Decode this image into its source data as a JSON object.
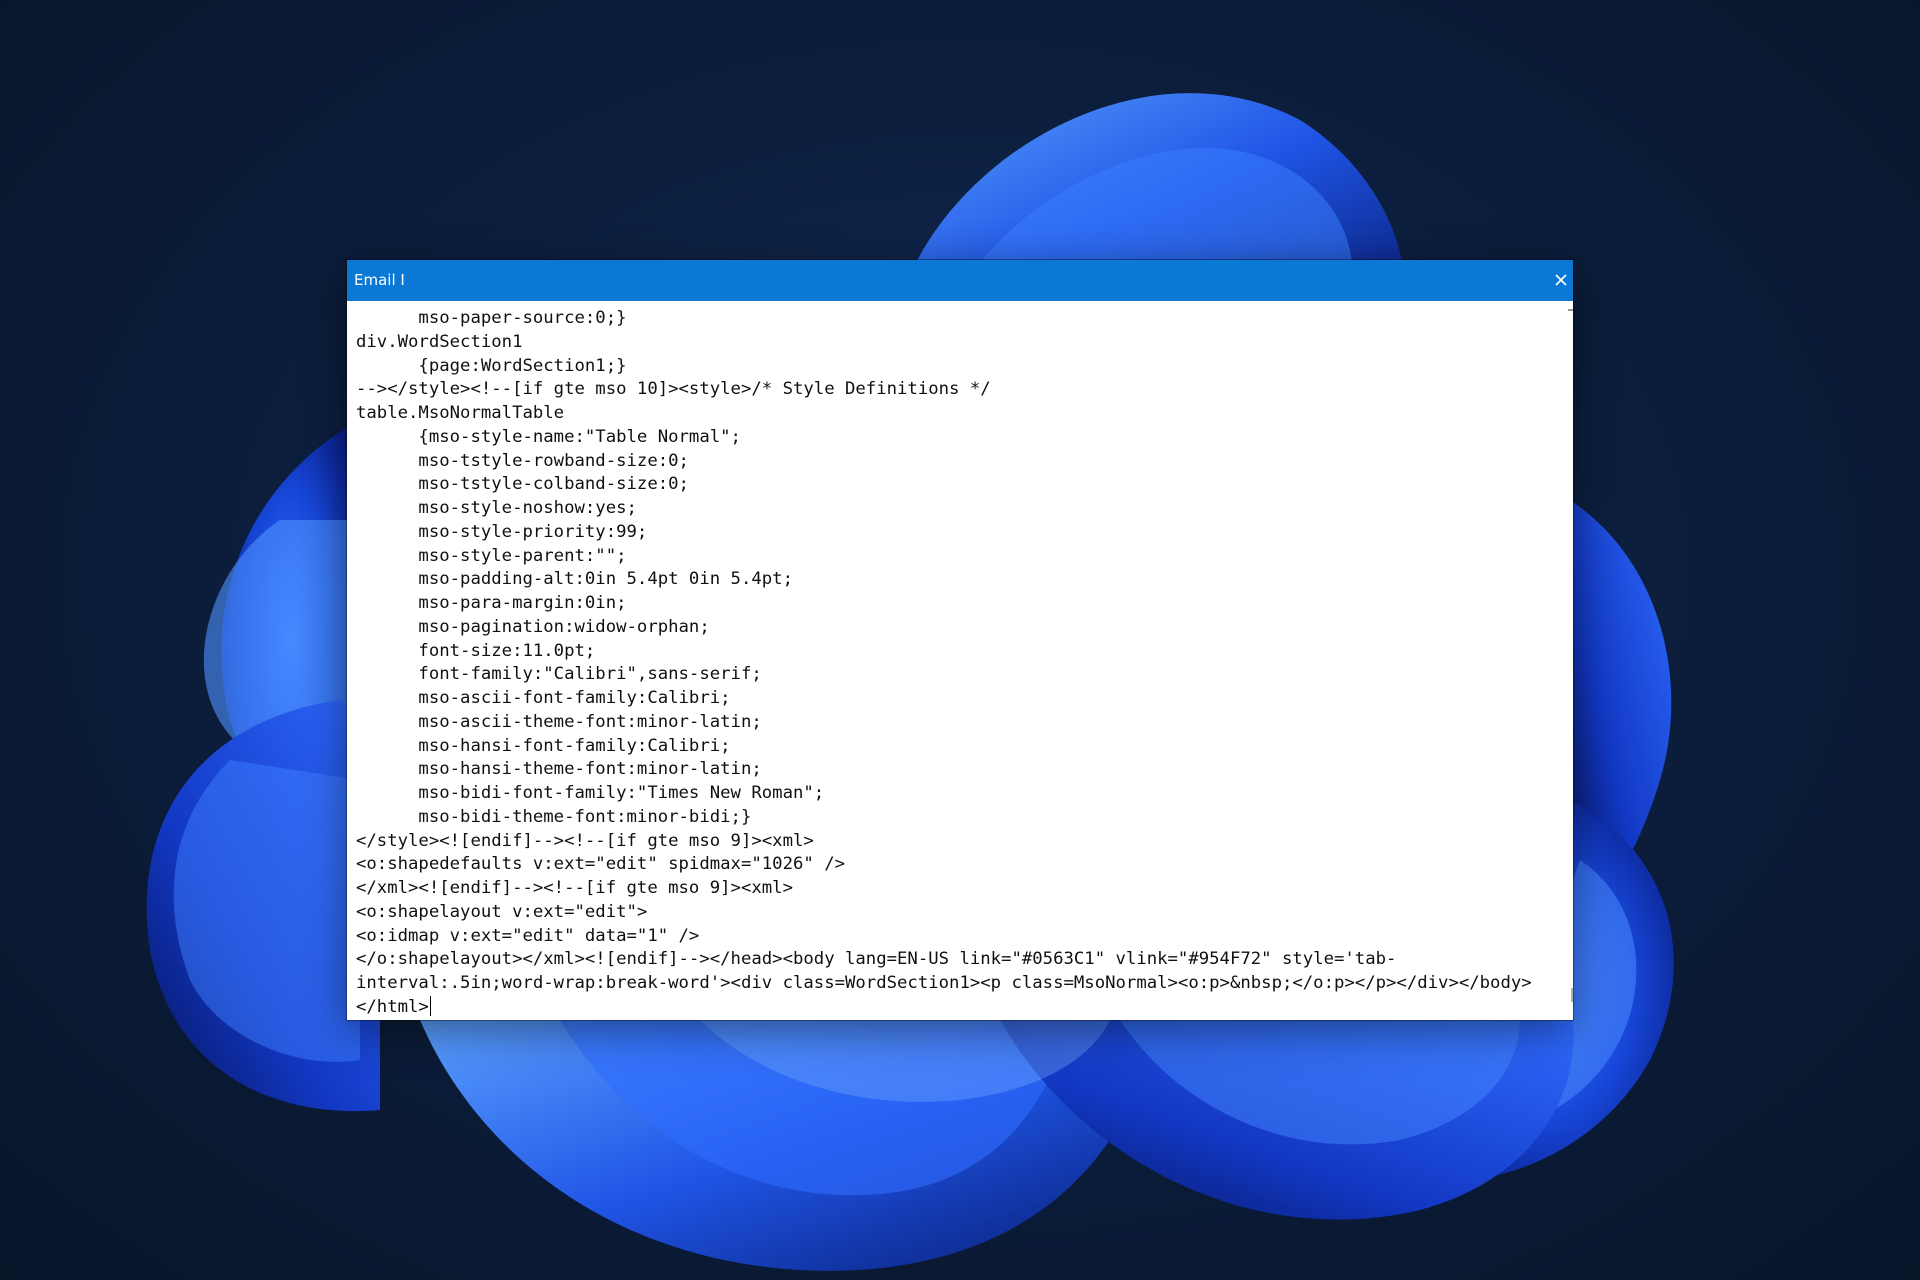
{
  "window": {
    "title": "Email I",
    "accent_color": "#0a78d4",
    "close_icon": "close-icon"
  },
  "editor": {
    "lines": [
      "      mso-paper-source:0;}",
      "div.WordSection1",
      "      {page:WordSection1;}",
      "--></style><!--[if gte mso 10]><style>/* Style Definitions */",
      "table.MsoNormalTable",
      "      {mso-style-name:\"Table Normal\";",
      "      mso-tstyle-rowband-size:0;",
      "      mso-tstyle-colband-size:0;",
      "      mso-style-noshow:yes;",
      "      mso-style-priority:99;",
      "      mso-style-parent:\"\";",
      "      mso-padding-alt:0in 5.4pt 0in 5.4pt;",
      "      mso-para-margin:0in;",
      "      mso-pagination:widow-orphan;",
      "      font-size:11.0pt;",
      "      font-family:\"Calibri\",sans-serif;",
      "      mso-ascii-font-family:Calibri;",
      "      mso-ascii-theme-font:minor-latin;",
      "      mso-hansi-font-family:Calibri;",
      "      mso-hansi-theme-font:minor-latin;",
      "      mso-bidi-font-family:\"Times New Roman\";",
      "      mso-bidi-theme-font:minor-bidi;}",
      "</style><![endif]--><!--[if gte mso 9]><xml>",
      "<o:shapedefaults v:ext=\"edit\" spidmax=\"1026\" />",
      "</xml><![endif]--><!--[if gte mso 9]><xml>",
      "<o:shapelayout v:ext=\"edit\">",
      "<o:idmap v:ext=\"edit\" data=\"1\" />",
      "</o:shapelayout></xml><![endif]--></head><body lang=EN-US link=\"#0563C1\" vlink=\"#954F72\" style='tab-",
      "interval:.5in;word-wrap:break-word'><div class=WordSection1><p class=MsoNormal><o:p>&nbsp;</o:p></p></div></body>",
      "</html>"
    ]
  }
}
